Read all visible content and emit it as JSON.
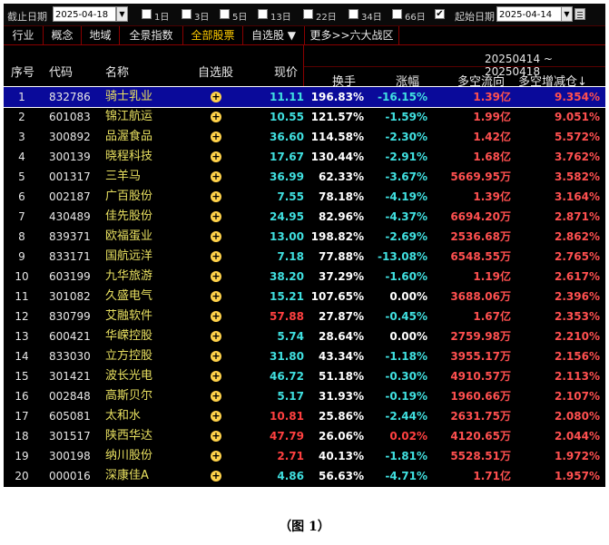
{
  "toolbar": {
    "end_date_label": "截止日期",
    "end_date_value": "2025-04-18",
    "periods": [
      {
        "label": "1日",
        "checked": false
      },
      {
        "label": "3日",
        "checked": false
      },
      {
        "label": "5日",
        "checked": false
      },
      {
        "label": "13日",
        "checked": false
      },
      {
        "label": "22日",
        "checked": false
      },
      {
        "label": "34日",
        "checked": false
      },
      {
        "label": "66日",
        "checked": false
      }
    ],
    "start_date_checked": true,
    "start_date_label": "起始日期",
    "start_date_value": "2025-04-14"
  },
  "tabs": [
    {
      "label": "行业",
      "active": false
    },
    {
      "label": "概念",
      "active": false
    },
    {
      "label": "地域",
      "active": false
    },
    {
      "label": "全景指数",
      "active": false
    },
    {
      "label": "全部股票",
      "active": true
    },
    {
      "label": "自选股 ▼",
      "active": false
    },
    {
      "label": "更多>>六大战区",
      "active": false
    }
  ],
  "header": {
    "idx": "序号",
    "code": "代码",
    "name": "名称",
    "watch": "自选股",
    "price": "现价",
    "range": "20250414 ~ 20250418",
    "turnover": "换手",
    "change": "涨幅",
    "flow": "多空流向",
    "position": "多空增减仓↓"
  },
  "colors": {
    "up": "#ff4040",
    "down": "#40e0e0",
    "flat": "#ffffff",
    "name": "#e8e060",
    "selected": "#0a0a9a"
  },
  "rows": [
    {
      "idx": "1",
      "code": "832786",
      "name": "骑士乳业",
      "price": "11.11",
      "turnover": "196.83%",
      "change": "-16.15%",
      "flow": "1.39",
      "flow_unit": "亿",
      "pct": "9.354%",
      "dir": "down"
    },
    {
      "idx": "2",
      "code": "601083",
      "name": "锦江航运",
      "price": "10.55",
      "turnover": "121.57%",
      "change": "-1.59%",
      "flow": "1.99",
      "flow_unit": "亿",
      "pct": "9.051%",
      "dir": "down"
    },
    {
      "idx": "3",
      "code": "300892",
      "name": "品渥食品",
      "price": "36.60",
      "turnover": "114.58%",
      "change": "-2.30%",
      "flow": "1.42",
      "flow_unit": "亿",
      "pct": "5.572%",
      "dir": "down"
    },
    {
      "idx": "4",
      "code": "300139",
      "name": "晓程科技",
      "price": "17.67",
      "turnover": "130.44%",
      "change": "-2.91%",
      "flow": "1.68",
      "flow_unit": "亿",
      "pct": "3.762%",
      "dir": "down"
    },
    {
      "idx": "5",
      "code": "001317",
      "name": "三羊马",
      "price": "36.99",
      "turnover": "62.33%",
      "change": "-3.67%",
      "flow": "5669.95",
      "flow_unit": "万",
      "pct": "3.582%",
      "dir": "down"
    },
    {
      "idx": "6",
      "code": "002187",
      "name": "广百股份",
      "price": "7.55",
      "turnover": "78.18%",
      "change": "-4.19%",
      "flow": "1.39",
      "flow_unit": "亿",
      "pct": "3.164%",
      "dir": "down"
    },
    {
      "idx": "7",
      "code": "430489",
      "name": "佳先股份",
      "price": "24.95",
      "turnover": "82.96%",
      "change": "-4.37%",
      "flow": "6694.20",
      "flow_unit": "万",
      "pct": "2.871%",
      "dir": "down"
    },
    {
      "idx": "8",
      "code": "839371",
      "name": "欧福蛋业",
      "price": "13.00",
      "turnover": "198.82%",
      "change": "-2.69%",
      "flow": "2536.68",
      "flow_unit": "万",
      "pct": "2.862%",
      "dir": "down"
    },
    {
      "idx": "9",
      "code": "833171",
      "name": "国航远洋",
      "price": "7.18",
      "turnover": "77.88%",
      "change": "-13.08%",
      "flow": "6548.55",
      "flow_unit": "万",
      "pct": "2.765%",
      "dir": "down"
    },
    {
      "idx": "10",
      "code": "603199",
      "name": "九华旅游",
      "price": "38.20",
      "turnover": "37.29%",
      "change": "-1.60%",
      "flow": "1.19",
      "flow_unit": "亿",
      "pct": "2.617%",
      "dir": "down"
    },
    {
      "idx": "11",
      "code": "301082",
      "name": "久盛电气",
      "price": "15.21",
      "turnover": "107.65%",
      "change": "0.00%",
      "flow": "3688.06",
      "flow_unit": "万",
      "pct": "2.396%",
      "dir": "flat"
    },
    {
      "idx": "12",
      "code": "830799",
      "name": "艾融软件",
      "price": "57.88",
      "turnover": "27.87%",
      "change": "-0.45%",
      "flow": "1.67",
      "flow_unit": "亿",
      "pct": "2.353%",
      "dir": "down",
      "price_dir": "up"
    },
    {
      "idx": "13",
      "code": "600421",
      "name": "华嵘控股",
      "price": "5.74",
      "turnover": "28.64%",
      "change": "0.00%",
      "flow": "2759.98",
      "flow_unit": "万",
      "pct": "2.210%",
      "dir": "flat"
    },
    {
      "idx": "14",
      "code": "833030",
      "name": "立方控股",
      "price": "31.80",
      "turnover": "43.34%",
      "change": "-1.18%",
      "flow": "3955.17",
      "flow_unit": "万",
      "pct": "2.156%",
      "dir": "down"
    },
    {
      "idx": "15",
      "code": "301421",
      "name": "波长光电",
      "price": "46.72",
      "turnover": "51.18%",
      "change": "-0.30%",
      "flow": "4910.57",
      "flow_unit": "万",
      "pct": "2.113%",
      "dir": "down"
    },
    {
      "idx": "16",
      "code": "002848",
      "name": "高斯贝尔",
      "price": "5.17",
      "turnover": "31.93%",
      "change": "-0.19%",
      "flow": "1960.66",
      "flow_unit": "万",
      "pct": "2.107%",
      "dir": "down"
    },
    {
      "idx": "17",
      "code": "605081",
      "name": "太和水",
      "price": "10.81",
      "turnover": "25.86%",
      "change": "-2.44%",
      "flow": "2631.75",
      "flow_unit": "万",
      "pct": "2.080%",
      "dir": "down",
      "price_dir": "up"
    },
    {
      "idx": "18",
      "code": "301517",
      "name": "陕西华达",
      "price": "47.79",
      "turnover": "26.06%",
      "change": "0.02%",
      "flow": "4120.65",
      "flow_unit": "万",
      "pct": "2.044%",
      "dir": "up"
    },
    {
      "idx": "19",
      "code": "300198",
      "name": "纳川股份",
      "price": "2.71",
      "turnover": "40.13%",
      "change": "-1.81%",
      "flow": "5528.51",
      "flow_unit": "万",
      "pct": "1.972%",
      "dir": "down",
      "price_dir": "up"
    },
    {
      "idx": "20",
      "code": "000016",
      "name": "深康佳A",
      "price": "4.86",
      "turnover": "56.63%",
      "change": "-4.71%",
      "flow": "1.71",
      "flow_unit": "亿",
      "pct": "1.957%",
      "dir": "down"
    }
  ],
  "selected_row": 0,
  "caption": "（图 1）"
}
